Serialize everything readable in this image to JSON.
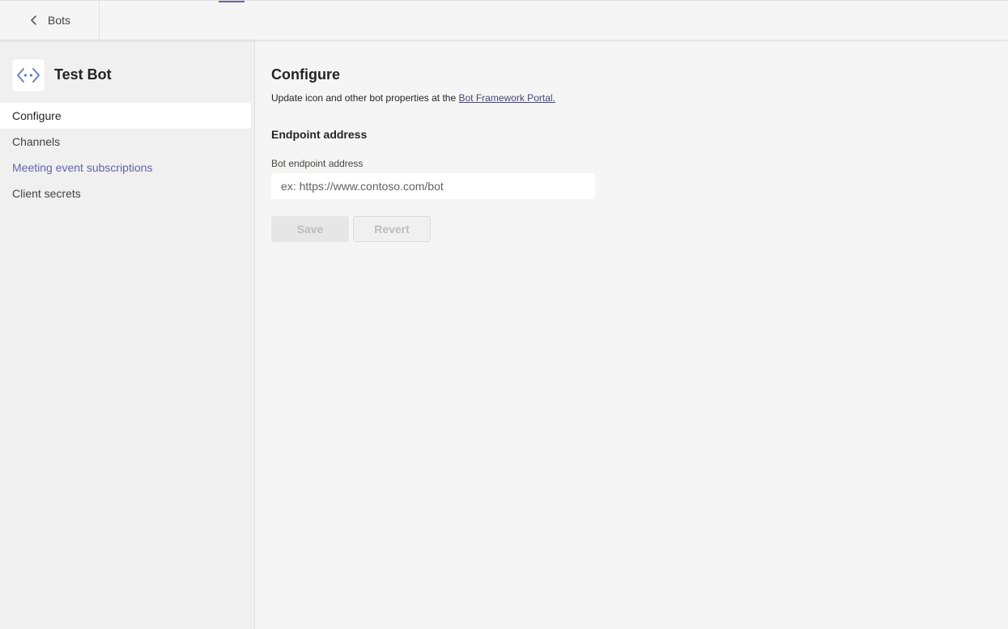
{
  "topbar": {
    "back_label": "Bots",
    "accent_color": "#6264a7"
  },
  "sidebar": {
    "app_name": "Test Bot",
    "app_icon": "bot-code-icon",
    "items": [
      {
        "label": "Configure",
        "state": "active"
      },
      {
        "label": "Channels",
        "state": "normal"
      },
      {
        "label": "Meeting event subscriptions",
        "state": "link"
      },
      {
        "label": "Client secrets",
        "state": "normal"
      }
    ]
  },
  "main": {
    "title": "Configure",
    "subtitle_prefix": "Update icon and other bot properties at the ",
    "subtitle_link": "Bot Framework Portal.",
    "section_title": "Endpoint address",
    "field_label": "Bot endpoint address",
    "field_value": "",
    "field_placeholder": "ex: https://www.contoso.com/bot",
    "save_label": "Save",
    "revert_label": "Revert"
  }
}
